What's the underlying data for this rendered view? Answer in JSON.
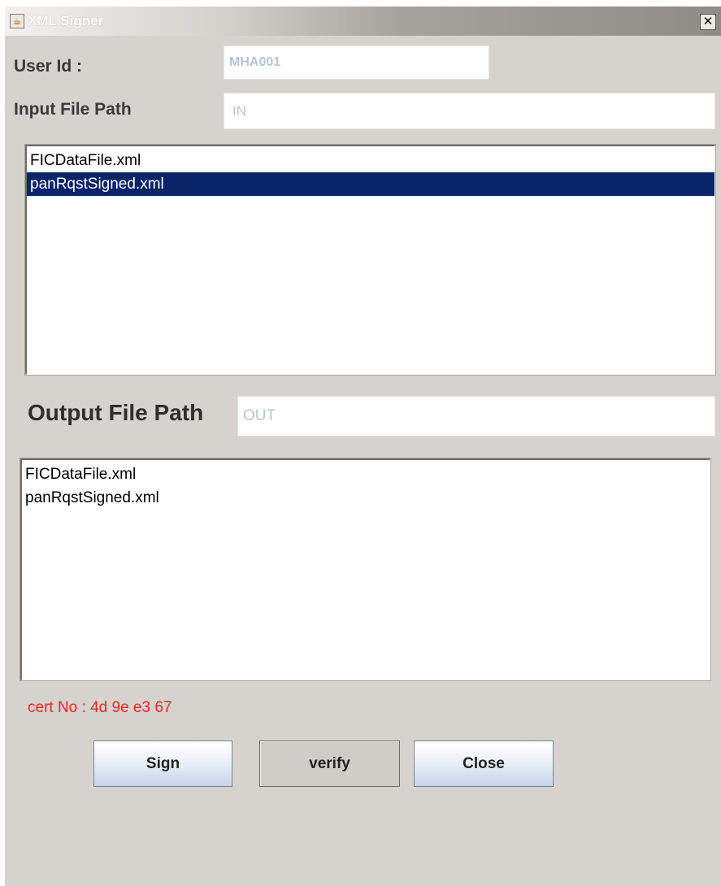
{
  "window": {
    "title": "XML Signer",
    "icon": "java-cup-icon",
    "close_glyph": "✕"
  },
  "form": {
    "user_id_label": "User Id :",
    "user_id_value": "MHA001",
    "input_path_label": "Input File Path",
    "input_path_value": "IN",
    "output_path_label": "Output File Path",
    "output_path_value": "OUT"
  },
  "input_files": {
    "items": [
      "FICDataFile.xml",
      "panRqstSigned.xml"
    ],
    "selected": "panRqstSigned.xml"
  },
  "output_files": {
    "items": [
      "FICDataFile.xml",
      "panRqstSigned.xml"
    ]
  },
  "cert": {
    "text": "cert No : 4d 9e e3 67",
    "color": "#ff2020"
  },
  "buttons": {
    "sign": "Sign",
    "verify": "verify",
    "close": "Close"
  },
  "colors": {
    "selection": "#0a246a",
    "window_bg": "#d6d3ce"
  }
}
